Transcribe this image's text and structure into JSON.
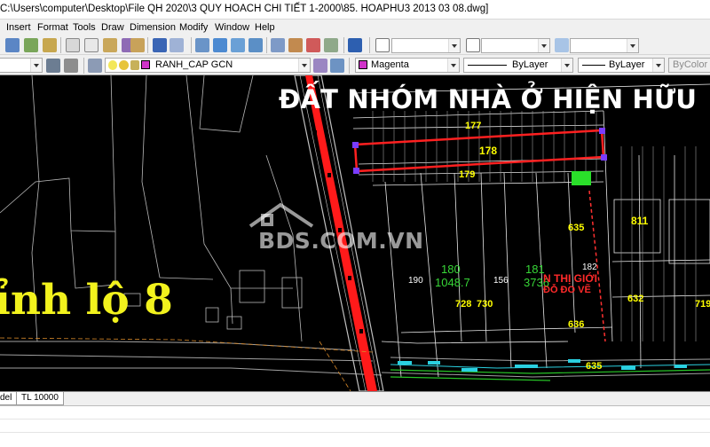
{
  "window": {
    "title": "C:\\Users\\computer\\Desktop\\File QH 2020\\3 QUY HOACH CHI TIẾT 1-2000\\85. HOAPHU3 2013 03 08.dwg]"
  },
  "menu": {
    "items": [
      "Insert",
      "Format",
      "Tools",
      "Draw",
      "Dimension",
      "Modify",
      "Window",
      "Help"
    ]
  },
  "toolbar": {
    "layer_name": "RANH_CAP GCN",
    "color": "Magenta",
    "linetype": "ByLayer",
    "lineweight": "ByLayer",
    "plotstyle": "ByColor"
  },
  "drawing": {
    "heading": "ĐẤT NHÓM NHÀ Ở HIỆN HỮU",
    "road_label": "ỉnh lộ 8",
    "watermark": "BDS.COM.VN",
    "parcels": [
      "177",
      "178",
      "179",
      "811",
      "635",
      "728",
      "730",
      "636",
      "632",
      "719",
      "635"
    ],
    "survey": [
      "180",
      "1048.7",
      "181",
      "3736",
      "182",
      "190",
      "156"
    ],
    "owner_label": "N THỊ GIỚI",
    "owner_label2": "ĐỖ ĐO VẼ",
    "colors": {
      "background": "#000000",
      "road_highlight": "#ff1a1a",
      "parcel_outline": "#ff2020",
      "road_text": "#f2f21d",
      "heading": "#ffffff"
    }
  },
  "layout_tabs": [
    "del",
    "TL 10000"
  ]
}
